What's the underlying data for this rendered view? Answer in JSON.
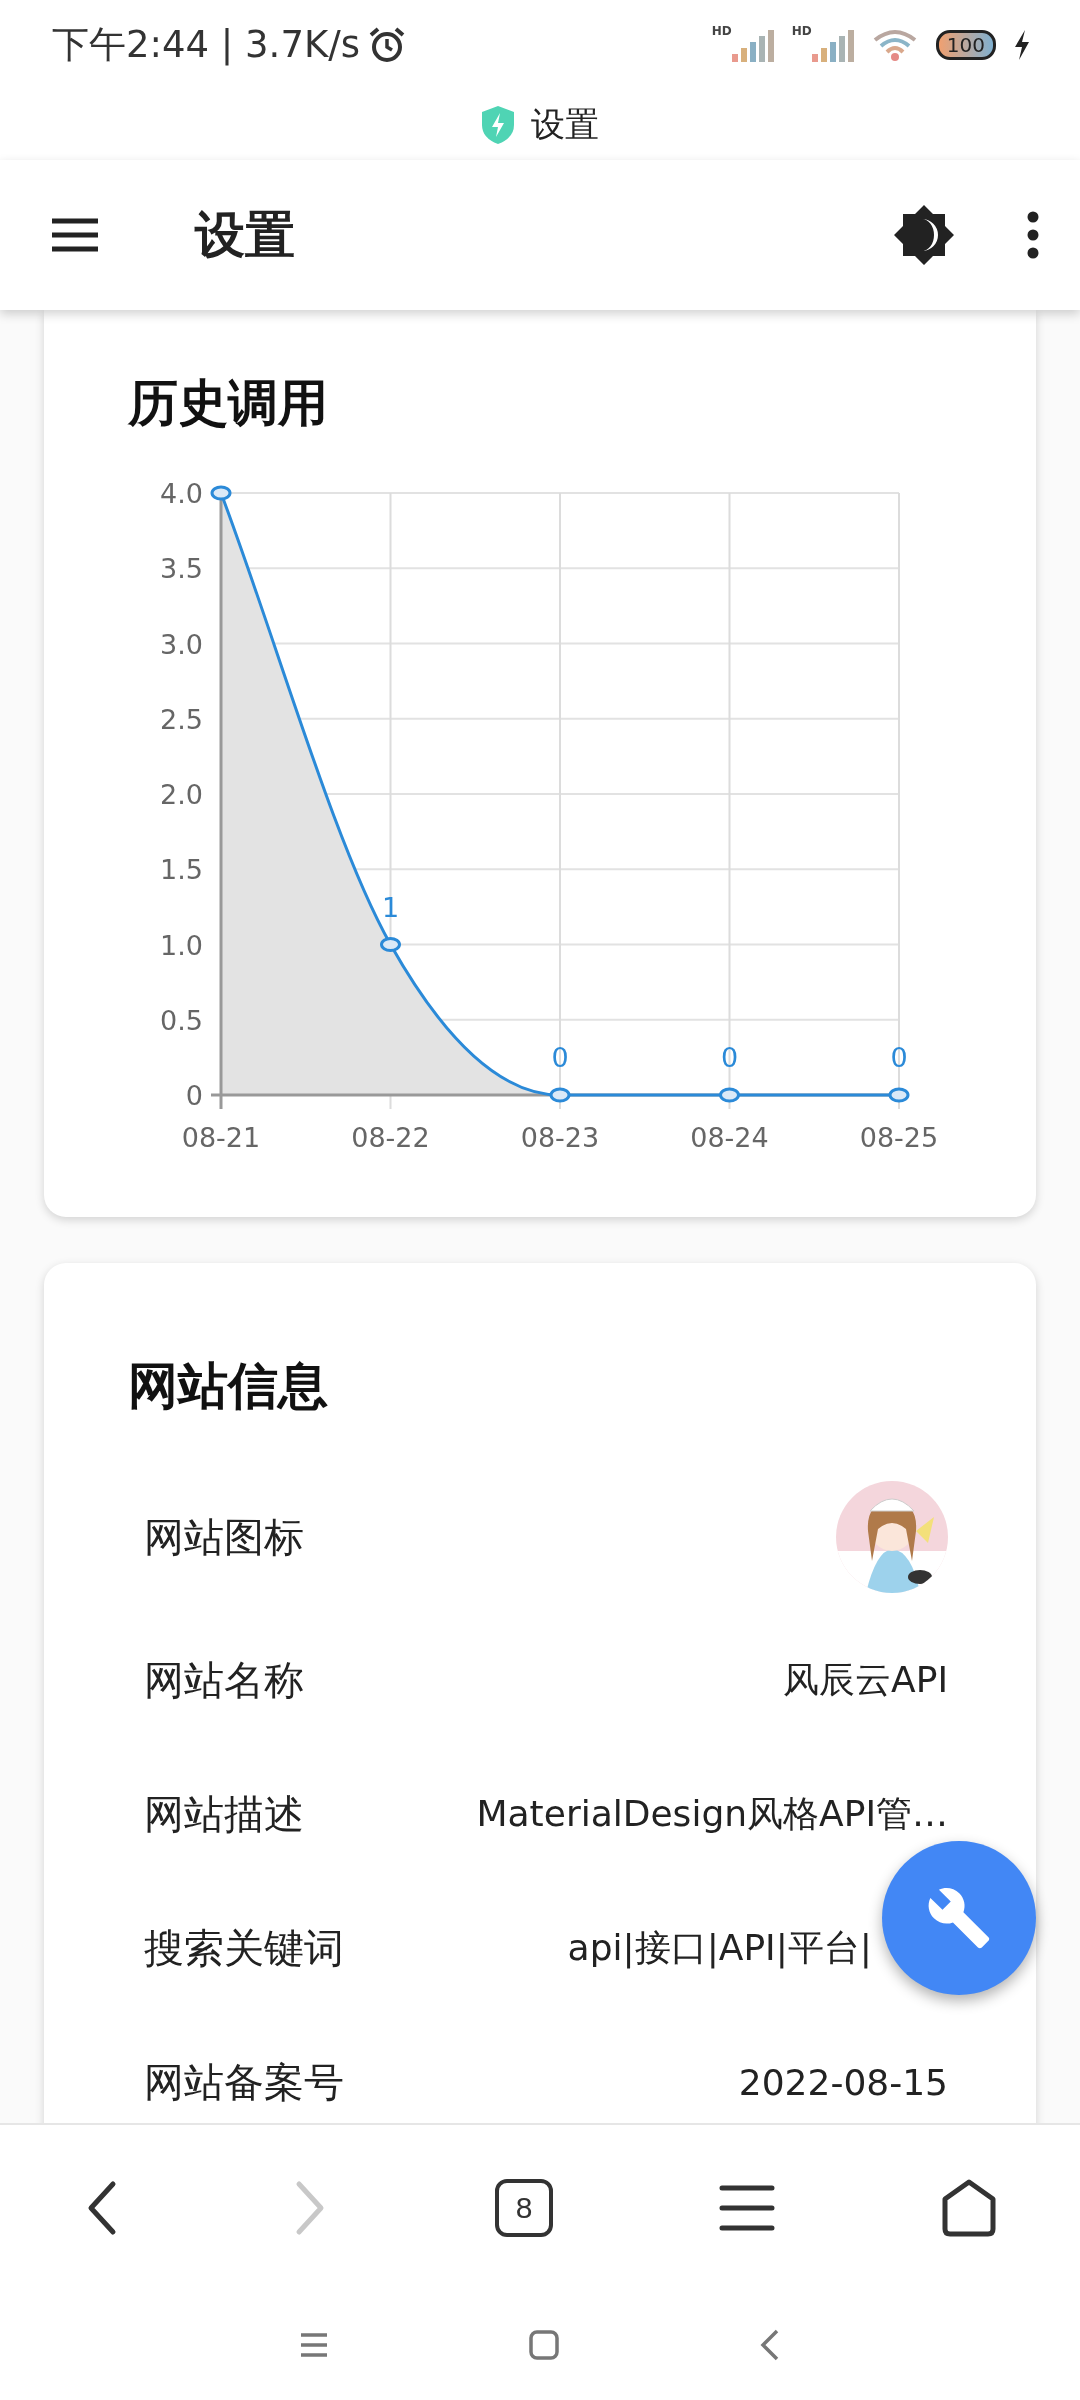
{
  "status_bar": {
    "time": "下午2:44 | 3.7K/s",
    "signal_labels": [
      "HD",
      "HD"
    ],
    "battery": "100"
  },
  "browser_title": "设置",
  "app_bar": {
    "title": "设置"
  },
  "history_card": {
    "title": "历史调用",
    "chart_data": {
      "type": "area",
      "categories": [
        "08-21",
        "08-22",
        "08-23",
        "08-24",
        "08-25"
      ],
      "series": [
        {
          "color": "#2b8ad8",
          "values": [
            4,
            1,
            0,
            0,
            0
          ]
        }
      ],
      "grid": true,
      "ylim": [
        0,
        4
      ],
      "yticks": [
        {
          "value": 0,
          "label": "0"
        },
        {
          "value": 0.5,
          "label": "0.5"
        },
        {
          "value": 1,
          "label": "1.0"
        },
        {
          "value": 1.5,
          "label": "1.5"
        },
        {
          "value": 2,
          "label": "2.0"
        },
        {
          "value": 2.5,
          "label": "2.5"
        },
        {
          "value": 3,
          "label": "3.0"
        },
        {
          "value": 3.5,
          "label": "3.5"
        },
        {
          "value": 4,
          "label": "4.0"
        }
      ],
      "value_labels": [
        null,
        "1",
        "0",
        "0",
        "0"
      ]
    }
  },
  "site_card": {
    "title": "网站信息",
    "rows": [
      {
        "label": "网站图标"
      },
      {
        "kind": "text",
        "label": "网站名称",
        "value": "风辰云API"
      },
      {
        "kind": "text",
        "label": "网站描述",
        "value": "MaterialDesign风格API管…"
      },
      {
        "kind": "partial",
        "label": "搜索关键词",
        "value": "api|接口|API|平台|"
      },
      {
        "kind": "text",
        "label": "网站备案号",
        "value": "2022-08-15"
      }
    ]
  },
  "browser_nav": [
    {
      "kind": "back",
      "disabled": false
    },
    {
      "kind": "forward",
      "disabled": true
    },
    {
      "kind": "tabs",
      "count": "8",
      "disabled": false
    },
    {
      "kind": "menu",
      "disabled": false
    },
    {
      "kind": "home",
      "disabled": false
    }
  ],
  "system_nav": [
    {
      "kind": "menu"
    },
    {
      "kind": "home"
    },
    {
      "kind": "back"
    }
  ]
}
